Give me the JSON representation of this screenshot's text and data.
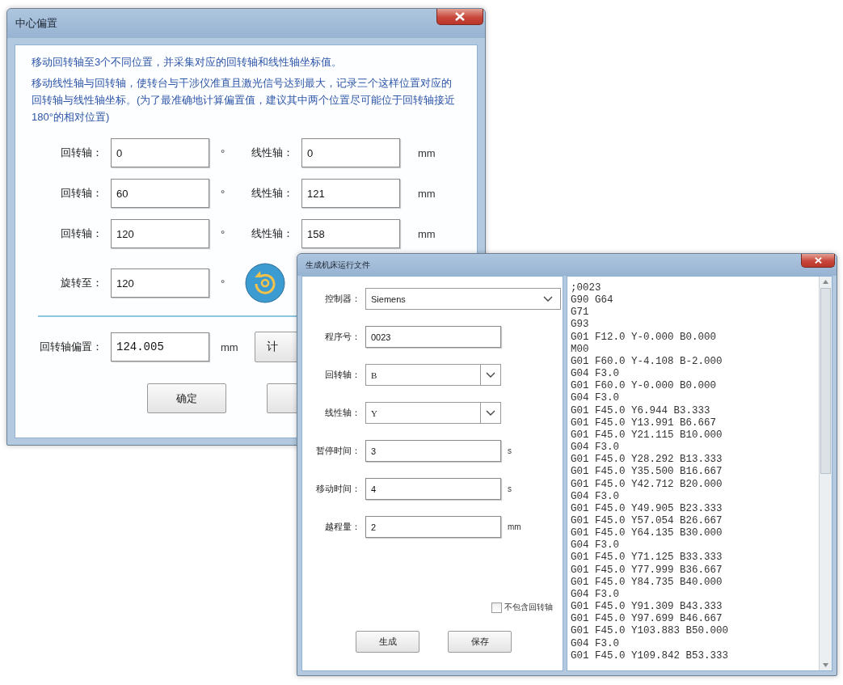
{
  "center_offset_dialog": {
    "title": "中心偏置",
    "instructions": [
      "移动回转轴至3个不同位置，并采集对应的回转轴和线性轴坐标值。",
      "移动线性轴与回转轴，使转台与干涉仪准直且激光信号达到最大，记录三个这样位置对应的回转轴与线性轴坐标。(为了最准确地计算偏置值，建议其中两个位置尽可能位于回转轴接近180°的相对位置)"
    ],
    "axis_rows": [
      {
        "rotary_label": "回转轴：",
        "rotary_value": "0",
        "rotary_unit": "°",
        "linear_label": "线性轴：",
        "linear_value": "0",
        "linear_unit": "mm"
      },
      {
        "rotary_label": "回转轴：",
        "rotary_value": "60",
        "rotary_unit": "°",
        "linear_label": "线性轴：",
        "linear_value": "121",
        "linear_unit": "mm"
      },
      {
        "rotary_label": "回转轴：",
        "rotary_value": "120",
        "rotary_unit": "°",
        "linear_label": "线性轴：",
        "linear_value": "158",
        "linear_unit": "mm"
      }
    ],
    "rotate_to": {
      "label": "旋转至：",
      "value": "120",
      "unit": "°"
    },
    "offset": {
      "label": "回转轴偏置：",
      "value": "124.005",
      "unit": "mm"
    },
    "calculate_button": "计",
    "buttons": [
      "确定"
    ]
  },
  "generate_file_dialog": {
    "title": "生成机床运行文件",
    "fields": [
      {
        "kind": "wide-select",
        "label": "控制器：",
        "value": "Siemens"
      },
      {
        "kind": "text",
        "label": "程序号：",
        "value": "0023"
      },
      {
        "kind": "select",
        "label": "回转轴：",
        "value": "B"
      },
      {
        "kind": "select",
        "label": "线性轴：",
        "value": "Y"
      },
      {
        "kind": "text",
        "label": "暂停时间：",
        "value": "3",
        "unit": "s"
      },
      {
        "kind": "text",
        "label": "移动时间：",
        "value": "4",
        "unit": "s"
      },
      {
        "kind": "text",
        "label": "越程量：",
        "value": "2",
        "unit": "mm"
      }
    ],
    "checkbox": {
      "label": "不包含回转轴",
      "checked": false
    },
    "buttons": [
      "生成",
      "保存"
    ],
    "code_lines": [
      ";0023",
      "G90 G64",
      "G71",
      "G93",
      "G01 F12.0 Y-0.000 B0.000",
      "M00",
      "G01 F60.0 Y-4.108 B-2.000",
      "G04 F3.0",
      "G01 F60.0 Y-0.000 B0.000",
      "G04 F3.0",
      "G01 F45.0 Y6.944 B3.333",
      "G01 F45.0 Y13.991 B6.667",
      "G01 F45.0 Y21.115 B10.000",
      "G04 F3.0",
      "G01 F45.0 Y28.292 B13.333",
      "G01 F45.0 Y35.500 B16.667",
      "G01 F45.0 Y42.712 B20.000",
      "G04 F3.0",
      "G01 F45.0 Y49.905 B23.333",
      "G01 F45.0 Y57.054 B26.667",
      "G01 F45.0 Y64.135 B30.000",
      "G04 F3.0",
      "G01 F45.0 Y71.125 B33.333",
      "G01 F45.0 Y77.999 B36.667",
      "G01 F45.0 Y84.735 B40.000",
      "G04 F3.0",
      "G01 F45.0 Y91.309 B43.333",
      "G01 F45.0 Y97.699 B46.667",
      "G01 F45.0 Y103.883 B50.000",
      "G04 F3.0",
      "G01 F45.0 Y109.842 B53.333"
    ]
  }
}
